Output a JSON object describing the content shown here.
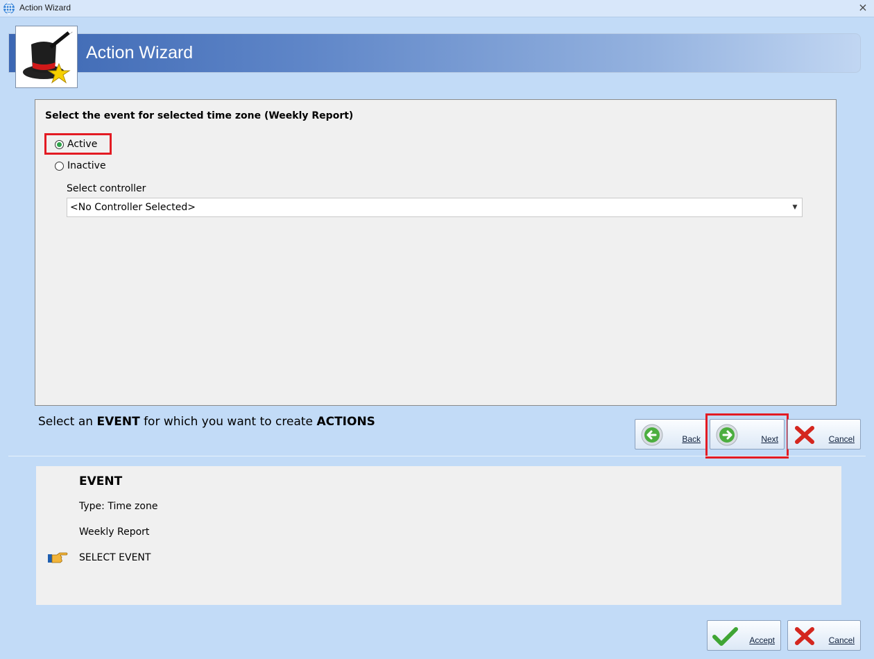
{
  "window": {
    "title": "Action Wizard",
    "close_glyph": "×"
  },
  "header": {
    "title": "Action Wizard",
    "logo_icon": "magic-hat-star-icon",
    "colors": {
      "gradient_start": "#3c67b3",
      "gradient_end": "#c1d6f2"
    }
  },
  "panel": {
    "heading": "Select the event for selected time zone (Weekly Report)",
    "options": [
      {
        "label": "Active",
        "selected": true
      },
      {
        "label": "Inactive",
        "selected": false
      }
    ],
    "controller_label": "Select controller",
    "controller_value": "<No Controller Selected>"
  },
  "instruction": {
    "part1": "Select an ",
    "em1": "EVENT",
    "part2": " for which you want to create ",
    "em2": "ACTIONS"
  },
  "nav_buttons": {
    "back": "Back",
    "next": "Next",
    "cancel": "Cancel"
  },
  "event_summary": {
    "title": "EVENT",
    "type": "Type: Time zone",
    "name": "Weekly Report",
    "step": "SELECT EVENT"
  },
  "footer_buttons": {
    "accept": "Accept",
    "cancel": "Cancel"
  },
  "highlight_color": "#e31b23"
}
